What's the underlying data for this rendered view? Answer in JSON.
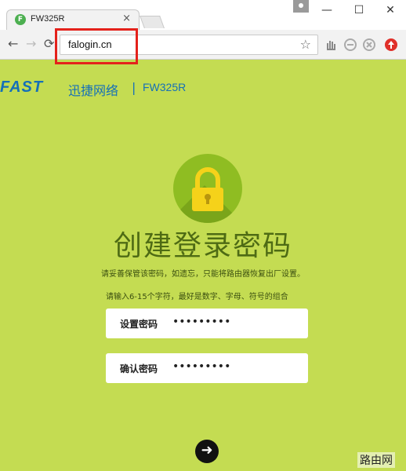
{
  "browser": {
    "tab_title": "FW325R",
    "tab_favicon": "F",
    "tab_close": "×",
    "window_minimize": "—",
    "window_maximize": "☐",
    "window_close": "✕",
    "back": "←",
    "forward": "→",
    "reload": "⟳",
    "url": "falogin.cn",
    "star": "☆"
  },
  "brand": {
    "logo": "FAST",
    "name_cn": "迅捷网络",
    "separator": "|",
    "model": "FW325R"
  },
  "page": {
    "title": "创建登录密码",
    "warning": "请妥善保管该密码，如遗忘，只能将路由器恢复出厂设置。",
    "hint": "请输入6-15个字符，最好是数字、字母、符号的组合",
    "password_label": "设置密码",
    "password_value": "•••••••••",
    "confirm_label": "确认密码",
    "confirm_value": "•••••••••",
    "next_arrow": "➜"
  },
  "watermark": "路由网",
  "colors": {
    "page_background": "#c4dc52",
    "brand_blue": "#1570b8",
    "title_green": "#4e6b14",
    "lock_yellow": "#f5d21a",
    "lock_circle": "#8fbd22",
    "highlight_red": "#e4211b"
  }
}
